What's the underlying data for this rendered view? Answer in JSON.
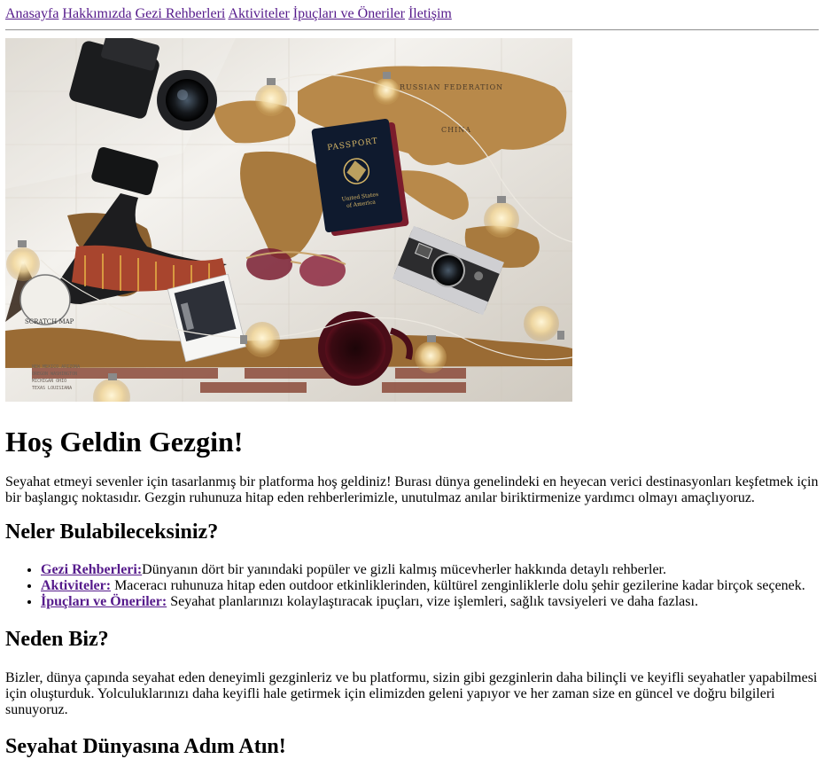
{
  "nav": {
    "items": [
      "Anasayfa",
      "Hakkımızda",
      "Gezi Rehberleri",
      "Aktiviteler",
      "İpuçları ve Öneriler",
      "İletişim"
    ]
  },
  "hero": {
    "alt": "travel-flatlay-world-map"
  },
  "welcome": {
    "title": "Hoş Geldin Gezgin!",
    "text": "Seyahat etmeyi sevenler için tasarlanmış bir platforma hoş geldiniz! Burası dünya genelindeki en heyecan verici destinasyonları keşfetmek için bir başlangıç noktasıdır. Gezgin ruhunuza hitap eden rehberlerimizle, unutulmaz anılar biriktirmenize yardımcı olmayı amaçlıyoruz."
  },
  "features": {
    "title": "Neler Bulabileceksiniz?",
    "items": [
      {
        "label": "Gezi Rehberleri:",
        "text": "Dünyanın dört bir yanındaki popüler ve gizli kalmış mücevherler hakkında detaylı rehberler."
      },
      {
        "label": "Aktiviteler:",
        "text": " Maceracı ruhunuza hitap eden outdoor etkinliklerinden, kültürel zenginliklerle dolu şehir gezilerine kadar birçok seçenek."
      },
      {
        "label": "İpuçları ve Öneriler:",
        "text": " Seyahat planlarınızı kolaylaştıracak ipuçları, vize işlemleri, sağlık tavsiyeleri ve daha fazlası."
      }
    ]
  },
  "why": {
    "title": "Neden Biz?",
    "text": "Bizler, dünya çapında seyahat eden deneyimli gezginleriz ve bu platformu, sizin gibi gezginlerin daha bilinçli ve keyifli seyahatler yapabilmesi için oluşturduk. Yolculuklarınızı daha keyifli hale getirmek için elimizden geleni yapıyor ve her zaman size en güncel ve doğru bilgileri sunuyoruz."
  },
  "next_section": {
    "title": "Seyahat Dünyasına Adım Atın!"
  },
  "passport": {
    "line1": "PASSPORT",
    "line2": "United States",
    "line3": "of America"
  },
  "map_labels": {
    "russia": "RUSSIAN FEDERATION",
    "china": "CHINA",
    "stamp": "SCRATCH MAP"
  }
}
